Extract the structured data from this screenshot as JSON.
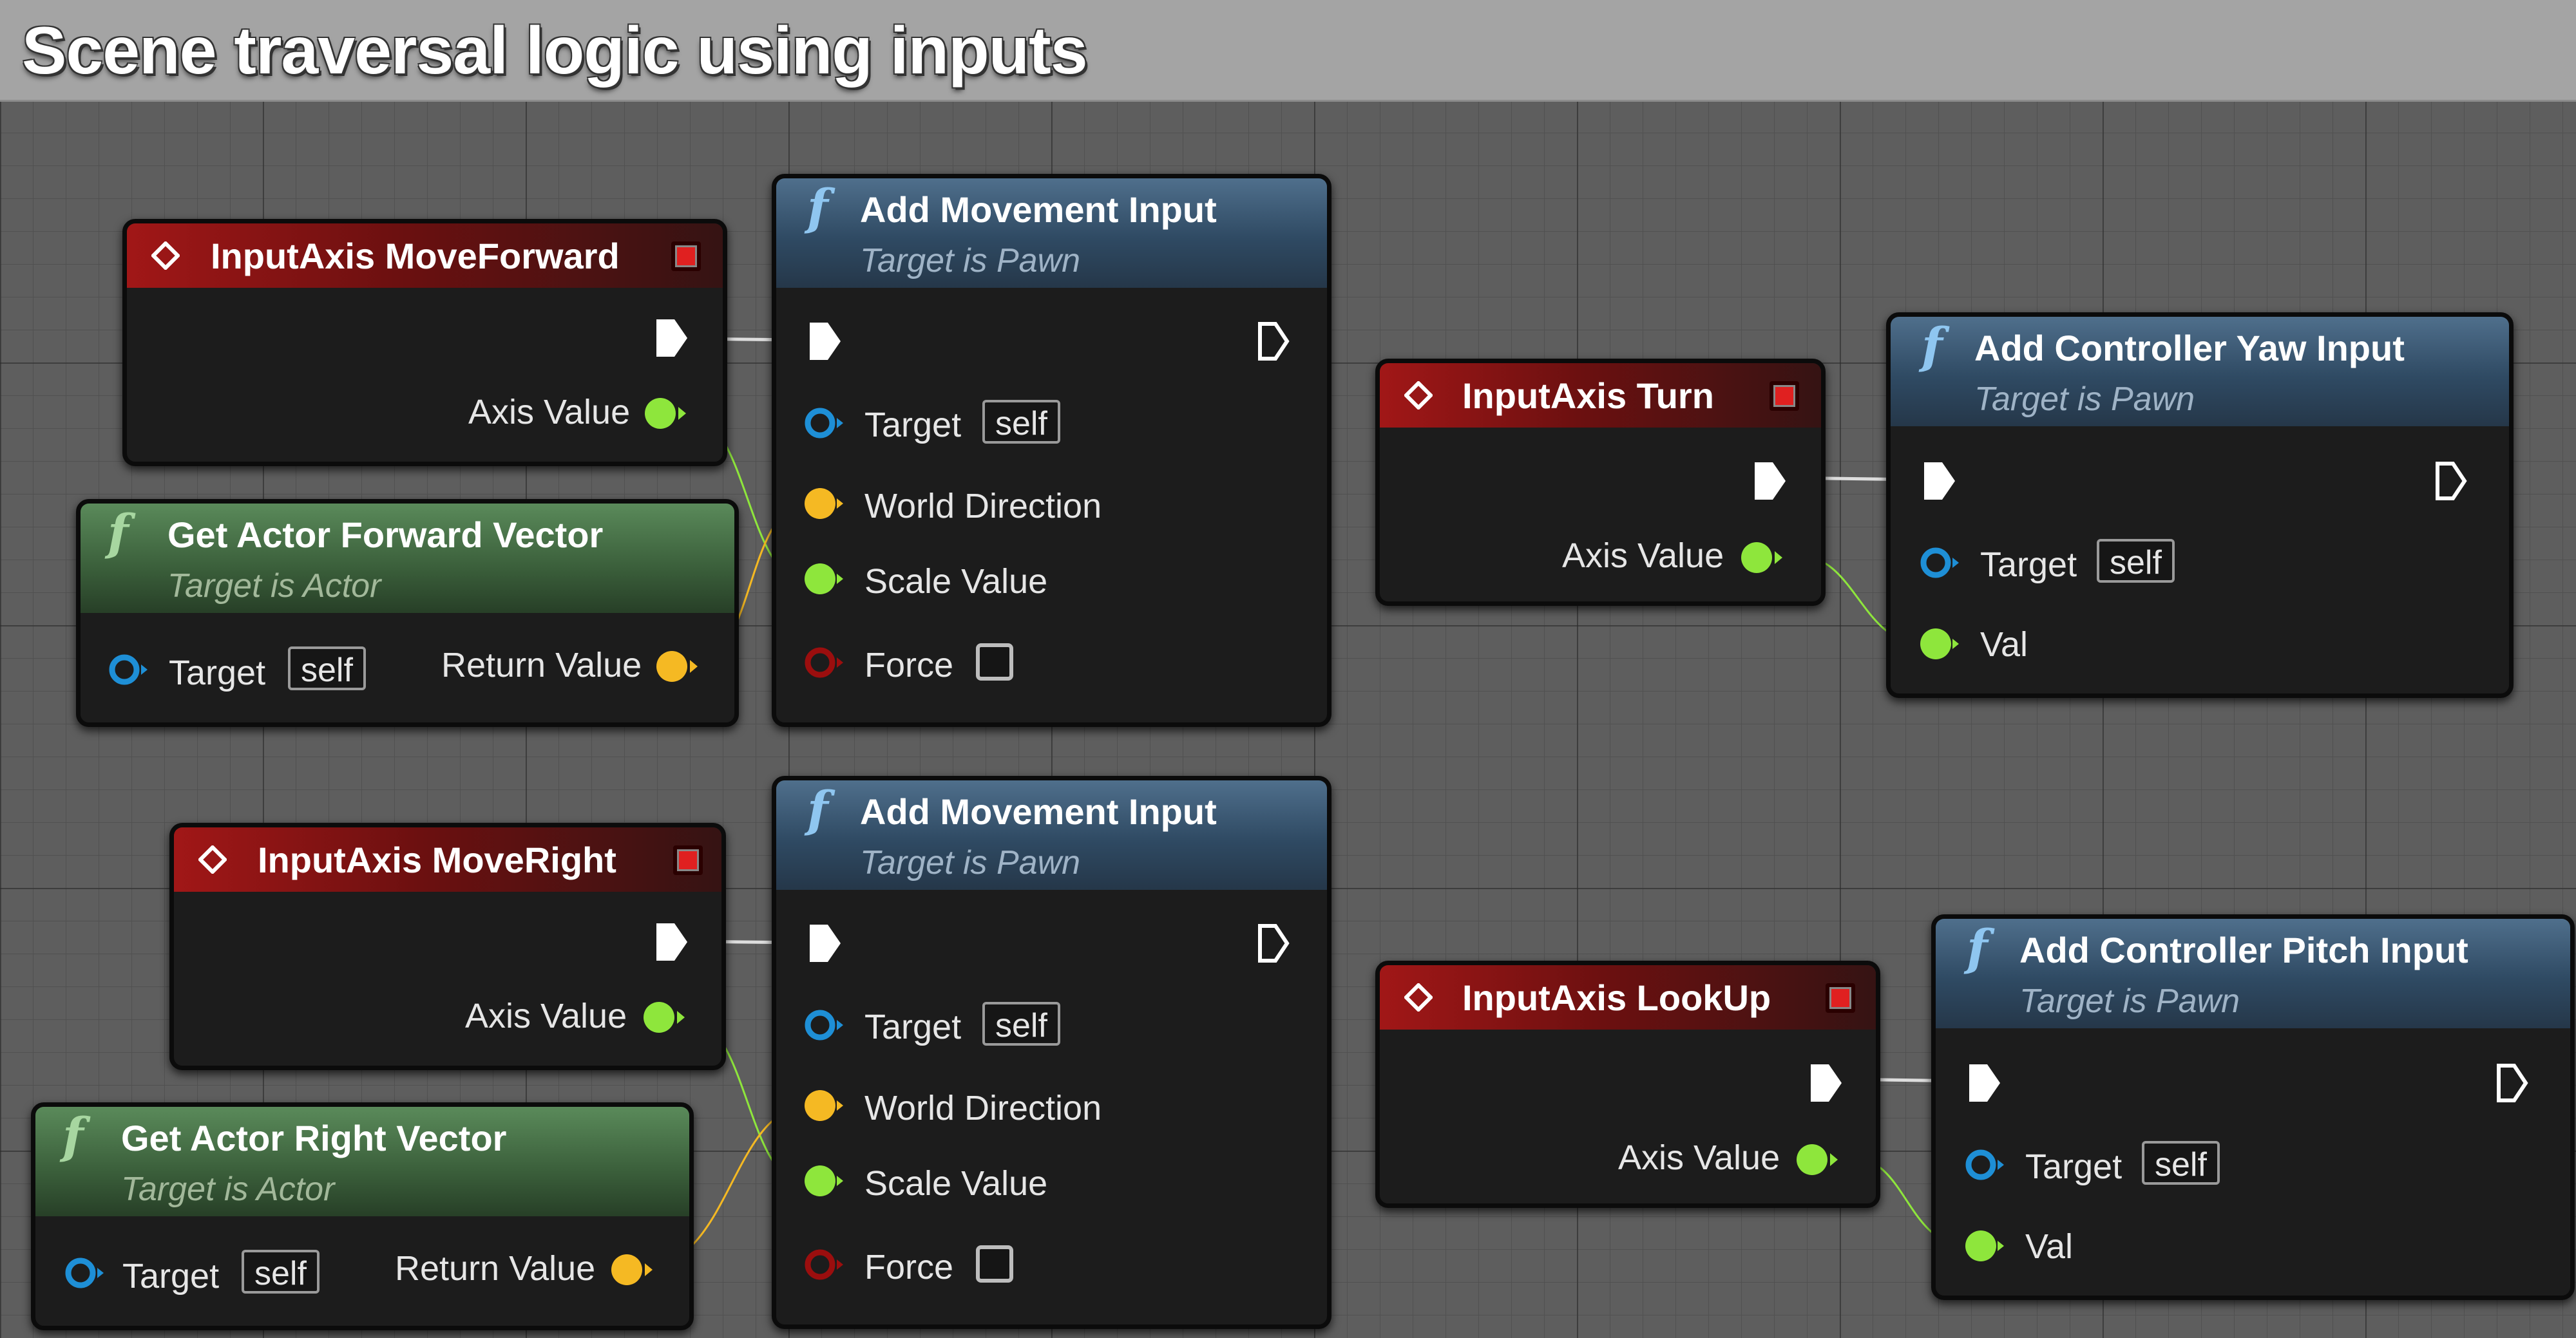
{
  "comment": {
    "title": "Scene traversal logic using inputs"
  },
  "colors": {
    "exec": "#ffffff",
    "float": "#8ee63c",
    "vector": "#f5b923",
    "object": "#1e8fd6",
    "bool": "#9b0e0e",
    "event_header": "#a11717",
    "function_header": "#2f4a63",
    "pure_header": "#3a5e3a"
  },
  "nodes": {
    "move_forward": {
      "title": "InputAxis MoveForward",
      "axis_value": "Axis Value"
    },
    "move_right": {
      "title": "InputAxis MoveRight",
      "axis_value": "Axis Value"
    },
    "turn": {
      "title": "InputAxis Turn",
      "axis_value": "Axis Value"
    },
    "look_up": {
      "title": "InputAxis LookUp",
      "axis_value": "Axis Value"
    },
    "forward_vector": {
      "title": "Get Actor Forward Vector",
      "subtitle": "Target is Actor",
      "target": "Target",
      "self": "self",
      "return": "Return Value"
    },
    "right_vector": {
      "title": "Get Actor Right Vector",
      "subtitle": "Target is Actor",
      "target": "Target",
      "self": "self",
      "return": "Return Value"
    },
    "add_movement_1": {
      "title": "Add Movement Input",
      "subtitle": "Target is Pawn",
      "target": "Target",
      "self": "self",
      "world_direction": "World Direction",
      "scale_value": "Scale Value",
      "force": "Force"
    },
    "add_movement_2": {
      "title": "Add Movement Input",
      "subtitle": "Target is Pawn",
      "target": "Target",
      "self": "self",
      "world_direction": "World Direction",
      "scale_value": "Scale Value",
      "force": "Force"
    },
    "yaw_input": {
      "title": "Add Controller Yaw Input",
      "subtitle": "Target is Pawn",
      "target": "Target",
      "self": "self",
      "val": "Val"
    },
    "pitch_input": {
      "title": "Add Controller Pitch Input",
      "subtitle": "Target is Pawn",
      "target": "Target",
      "self": "self",
      "val": "Val"
    }
  },
  "icons": {
    "function": "f",
    "event": "event-diamond-icon",
    "stop": "stop-icon"
  }
}
